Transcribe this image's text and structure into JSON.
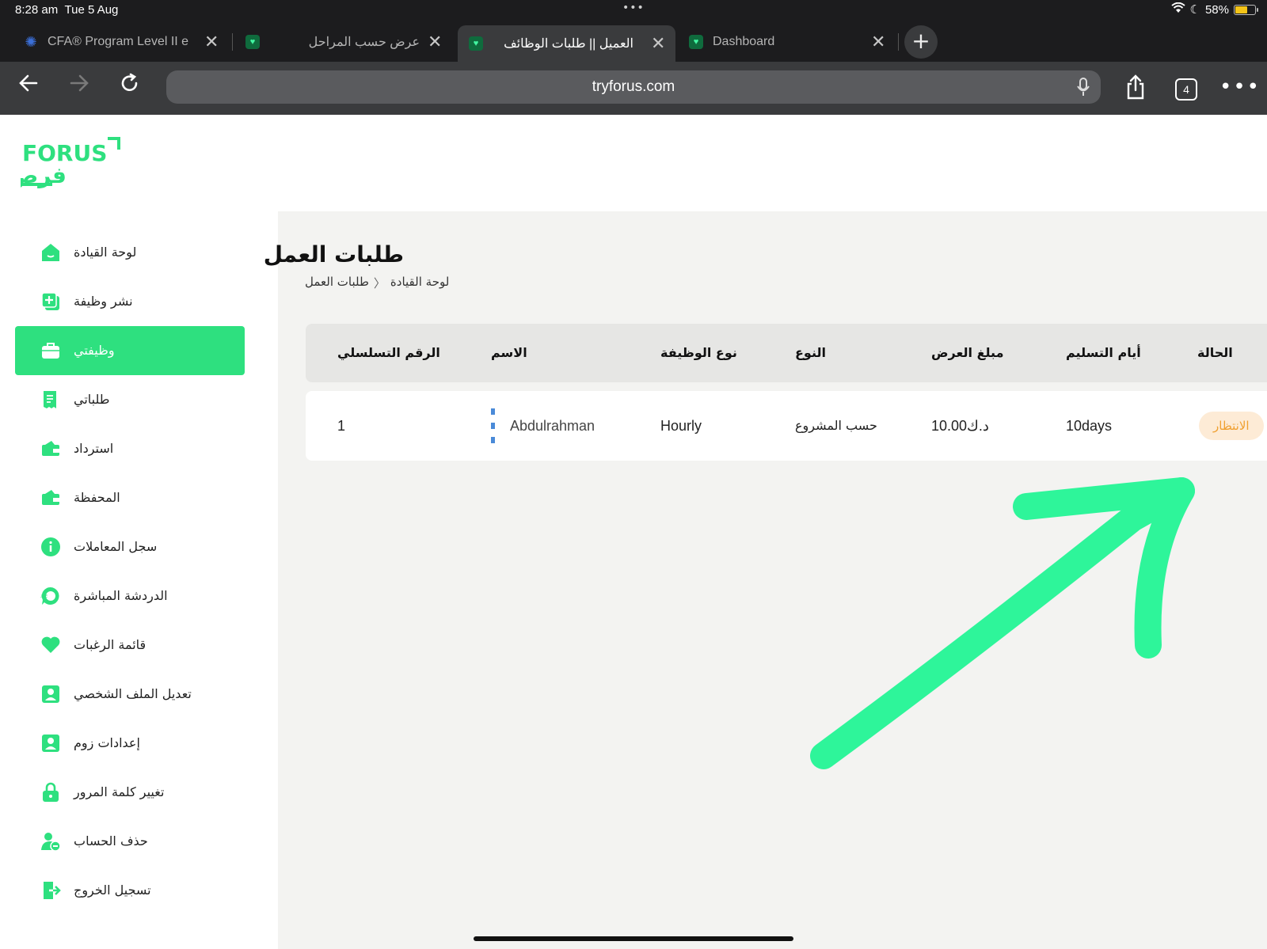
{
  "status_bar": {
    "time": "8:28 am",
    "date": "Tue 5 Aug",
    "battery": "58%",
    "battery_level": 0.58,
    "dots": "•••"
  },
  "tabs": [
    {
      "title": "CFA® Program Level II e",
      "icon": "cfa-icon",
      "active": false
    },
    {
      "title": "عرض حسب المراحل",
      "icon": "forus-favicon",
      "active": false
    },
    {
      "title": "العميل || طلبات الوظائف",
      "icon": "forus-favicon",
      "active": true
    },
    {
      "title": "Dashboard",
      "icon": "forus-favicon",
      "active": false
    }
  ],
  "toolbar": {
    "url": "tryforus.com",
    "tab_count": "4"
  },
  "logo": {
    "latin": "FORUS",
    "arabic": "فرص"
  },
  "sidebar": {
    "items": [
      {
        "label": "لوحة القيادة",
        "icon": "dashboard-icon",
        "active": false
      },
      {
        "label": "نشر وظيفة",
        "icon": "post-job-icon",
        "active": false
      },
      {
        "label": "وظيفتي",
        "icon": "briefcase-icon",
        "active": true
      },
      {
        "label": "طلباتي",
        "icon": "receipt-icon",
        "active": false
      },
      {
        "label": "استرداد",
        "icon": "refund-icon",
        "active": false
      },
      {
        "label": "المحفظة",
        "icon": "wallet-icon",
        "active": false
      },
      {
        "label": "سجل المعاملات",
        "icon": "info-icon",
        "active": false
      },
      {
        "label": "الدردشة المباشرة",
        "icon": "live-chat-icon",
        "active": false
      },
      {
        "label": "قائمة الرغبات",
        "icon": "heart-icon",
        "active": false
      },
      {
        "label": "تعديل الملف الشخصي",
        "icon": "profile-icon",
        "active": false
      },
      {
        "label": "إعدادات زوم",
        "icon": "zoom-settings-icon",
        "active": false
      },
      {
        "label": "تغيير كلمة المرور",
        "icon": "lock-icon",
        "active": false
      },
      {
        "label": "حذف الحساب",
        "icon": "delete-user-icon",
        "active": false
      },
      {
        "label": "تسجيل الخروج",
        "icon": "logout-icon",
        "active": false
      }
    ]
  },
  "main": {
    "title": "طلبات العمل",
    "breadcrumb": [
      "لوحة القيادة",
      "طلبات العمل"
    ],
    "breadcrumb_sep": "〈",
    "table": {
      "headers": {
        "serial": "الرقم التسلسلي",
        "name": "الاسم",
        "job_type": "نوع الوظيفة",
        "type": "النوع",
        "offer_amount": "مبلغ العرض",
        "delivery_days": "أيام التسليم",
        "status": "الحالة"
      },
      "rows": [
        {
          "serial": "1",
          "name": "Abdulrahman",
          "job_type": "Hourly",
          "type": "حسب المشروع",
          "offer_amount": "10.00د.ك",
          "delivery_days": "10days",
          "status": "الانتظار"
        }
      ]
    }
  },
  "colors": {
    "brand_green": "#2ee07f",
    "annotation_green": "#2ef59a",
    "status_pending": "#f0a030"
  }
}
